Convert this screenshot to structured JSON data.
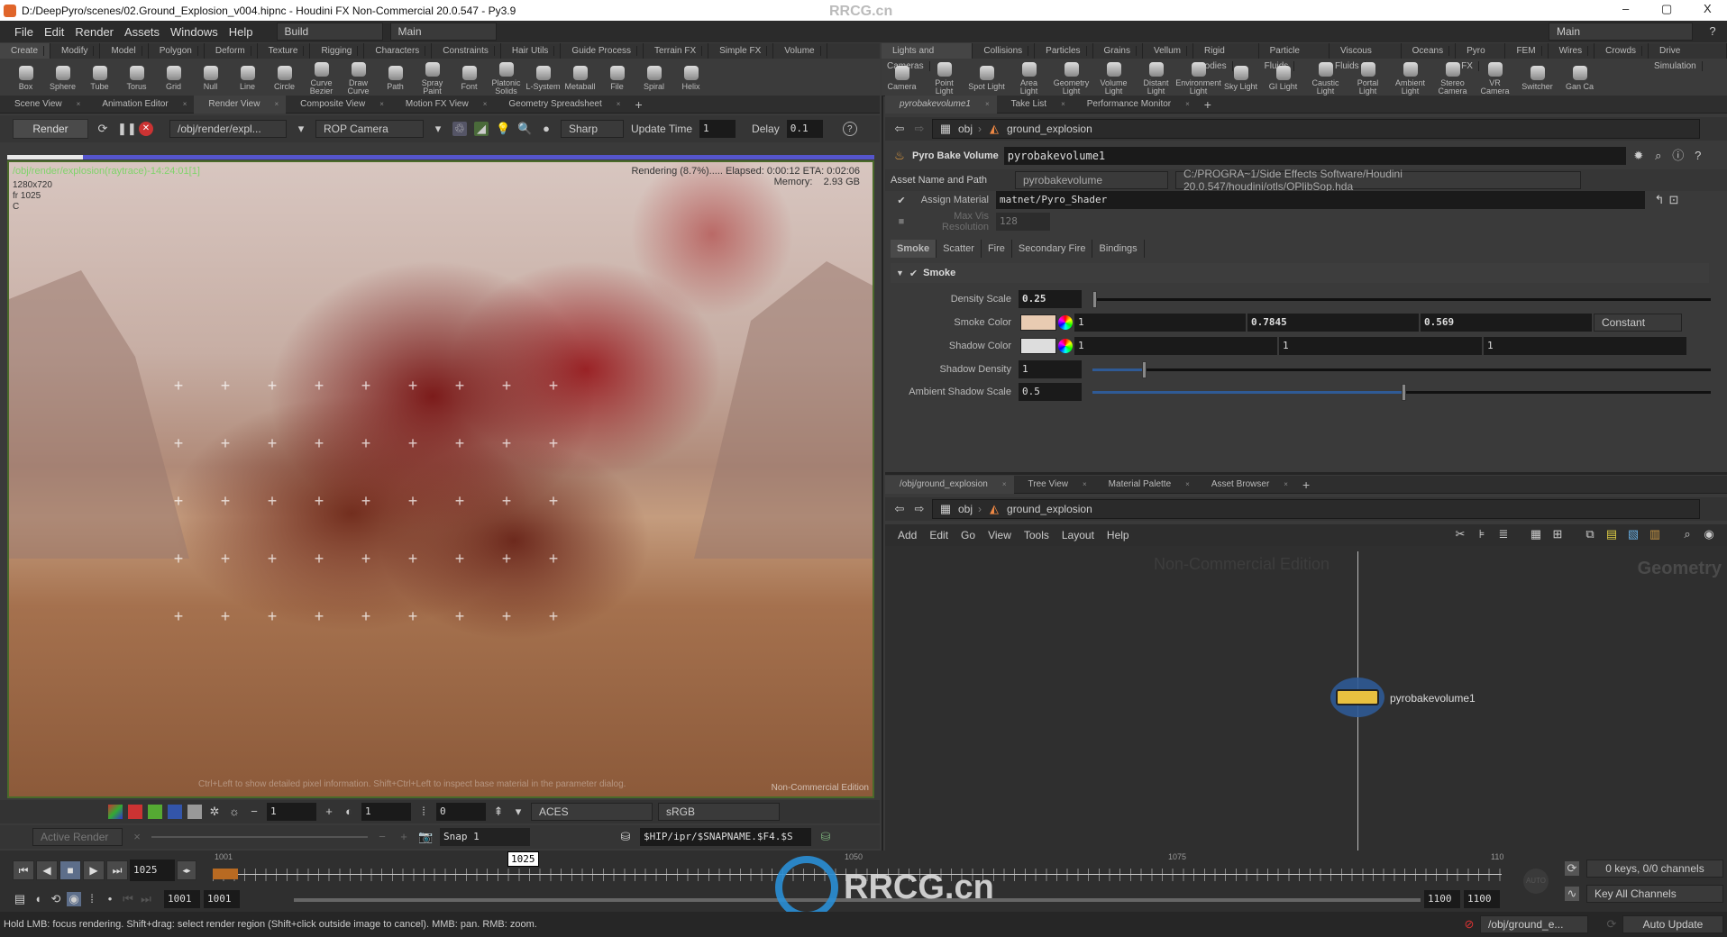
{
  "window": {
    "title": "D:/DeepPyro/scenes/02.Ground_Explosion_v004.hipnc - Houdini FX Non-Commercial 20.0.547 - Py3.9",
    "watermark": "RRCG.cn",
    "minimize": "–",
    "maximize": "▢",
    "close": "X"
  },
  "menu": {
    "items": [
      "File",
      "Edit",
      "Render",
      "Assets",
      "Windows",
      "Help"
    ],
    "desktop": "Build",
    "desktop_right": "Main",
    "main": "Main"
  },
  "shelf_left": {
    "tabs": [
      "Create",
      "Modify",
      "Model",
      "Polygon",
      "Deform",
      "Texture",
      "Rigging",
      "Characters",
      "Constraints",
      "Hair Utils",
      "Guide Process",
      "Terrain FX",
      "Simple FX",
      "Volume"
    ],
    "tools": [
      "Box",
      "Sphere",
      "Tube",
      "Torus",
      "Grid",
      "Null",
      "Line",
      "Circle",
      "Curve Bezier",
      "Draw Curve",
      "Path",
      "Spray Paint",
      "Font",
      "Platonic Solids",
      "L-System",
      "Metaball",
      "File",
      "Spiral",
      "Helix"
    ]
  },
  "shelf_right": {
    "tabs": [
      "Lights and Cameras",
      "Collisions",
      "Particles",
      "Grains",
      "Vellum",
      "Rigid Bodies",
      "Particle Fluids",
      "Viscous Fluids",
      "Oceans",
      "Pyro FX",
      "FEM",
      "Wires",
      "Crowds",
      "Drive Simulation"
    ],
    "tools": [
      "Camera",
      "Point Light",
      "Spot Light",
      "Area Light",
      "Geometry Light",
      "Volume Light",
      "Distant Light",
      "Environment Light",
      "Sky Light",
      "GI Light",
      "Caustic Light",
      "Portal Light",
      "Ambient Light",
      "Stereo Camera",
      "VR Camera",
      "Switcher",
      "Gan Ca"
    ]
  },
  "left_pane": {
    "tabs": [
      "Scene View",
      "Animation Editor",
      "Render View",
      "Composite View",
      "Motion FX View",
      "Geometry Spreadsheet"
    ],
    "active_tab": 2
  },
  "render_toolbar": {
    "render": "Render",
    "rop": "/obj/render/expl...",
    "camera": "ROP Camera",
    "filter": "Sharp",
    "update_time_label": "Update Time",
    "update_time": "1",
    "delay_label": "Delay",
    "delay": "0.1",
    "progress": 0.087
  },
  "render_view": {
    "path": "/obj/render/explosion(raytrace)-14:24:01[1]",
    "res": "1280x720",
    "frame": "fr 1025",
    "channel": "C",
    "status": "Rendering (8.7%).....  Elapsed: 0:00:12  ETA: 0:02:06",
    "memory_label": "Memory:",
    "memory": "2.93 GB",
    "hint": "Ctrl+Left to show detailed pixel information. Shift+Ctrl+Left to inspect base material in the parameter dialog.",
    "edition": "Non-Commercial Edition"
  },
  "render_bottom": {
    "exposure": "1",
    "gamma": "1",
    "lut": "0",
    "ocio_view": "ACES",
    "display": "sRGB",
    "active_render": "Active Render",
    "snap": "Snap 1",
    "snap_path": "$HIP/ipr/$SNAPNAME.$F4.$S"
  },
  "timeline": {
    "frame": "1025",
    "marker": "1025",
    "start": "1001",
    "start2": "1001",
    "end": "1100",
    "end2": "1100",
    "labels": [
      "1001",
      "1050",
      "1075",
      "110"
    ],
    "keys": "0 keys, 0/0 channels",
    "key_mode": "Key All Channels",
    "auto": "AUTO"
  },
  "status": {
    "text": "Hold LMB: focus rendering. Shift+drag: select render region (Shift+click outside image to cancel). MMB: pan. RMB: zoom.",
    "path": "/obj/ground_e...",
    "update": "Auto Update"
  },
  "param_pane": {
    "tabs": [
      "pyrobakevolume1",
      "Take List",
      "Performance Monitor"
    ],
    "path_root": "obj",
    "path_node": "ground_explosion",
    "node_type": "Pyro Bake Volume",
    "node_name": "pyrobakevolume1",
    "asset_label": "Asset Name and Path",
    "asset_name": "pyrobakevolume",
    "asset_path": "C:/PROGRA~1/Side Effects Software/Houdini 20.0.547/houdini/otls/OPlibSop.hda",
    "assign_material_label": "Assign Material",
    "assign_material": "matnet/Pyro_Shader",
    "max_vis_label": "Max Vis Resolution",
    "max_vis": "128",
    "tabs2": [
      "Smoke",
      "Scatter",
      "Fire",
      "Secondary Fire",
      "Bindings"
    ],
    "folder": "Smoke",
    "density_label": "Density Scale",
    "density": "0.25",
    "smoke_color_label": "Smoke Color",
    "smoke_color": [
      "1",
      "0.7845",
      "0.569"
    ],
    "smoke_swatch": "#e8cbb2",
    "smoke_mode": "Constant",
    "shadow_color_label": "Shadow Color",
    "shadow_color": [
      "1",
      "1",
      "1"
    ],
    "shadow_swatch": "#dddddd",
    "shadow_density_label": "Shadow Density",
    "shadow_density": "1",
    "ambient_label": "Ambient Shadow Scale",
    "ambient": "0.5"
  },
  "network_pane": {
    "tabs": [
      "/obj/ground_explosion",
      "Tree View",
      "Material Palette",
      "Asset Browser"
    ],
    "path_root": "obj",
    "path_node": "ground_explosion",
    "menu": [
      "Add",
      "Edit",
      "Go",
      "View",
      "Tools",
      "Layout",
      "Help"
    ],
    "watermark": "Non-Commercial Edition",
    "context": "Geometry",
    "node": "pyrobakevolume1"
  },
  "colors": {
    "accent": "#2f5a95",
    "progress": "#5555cc",
    "render_path": "#7fd36a"
  }
}
